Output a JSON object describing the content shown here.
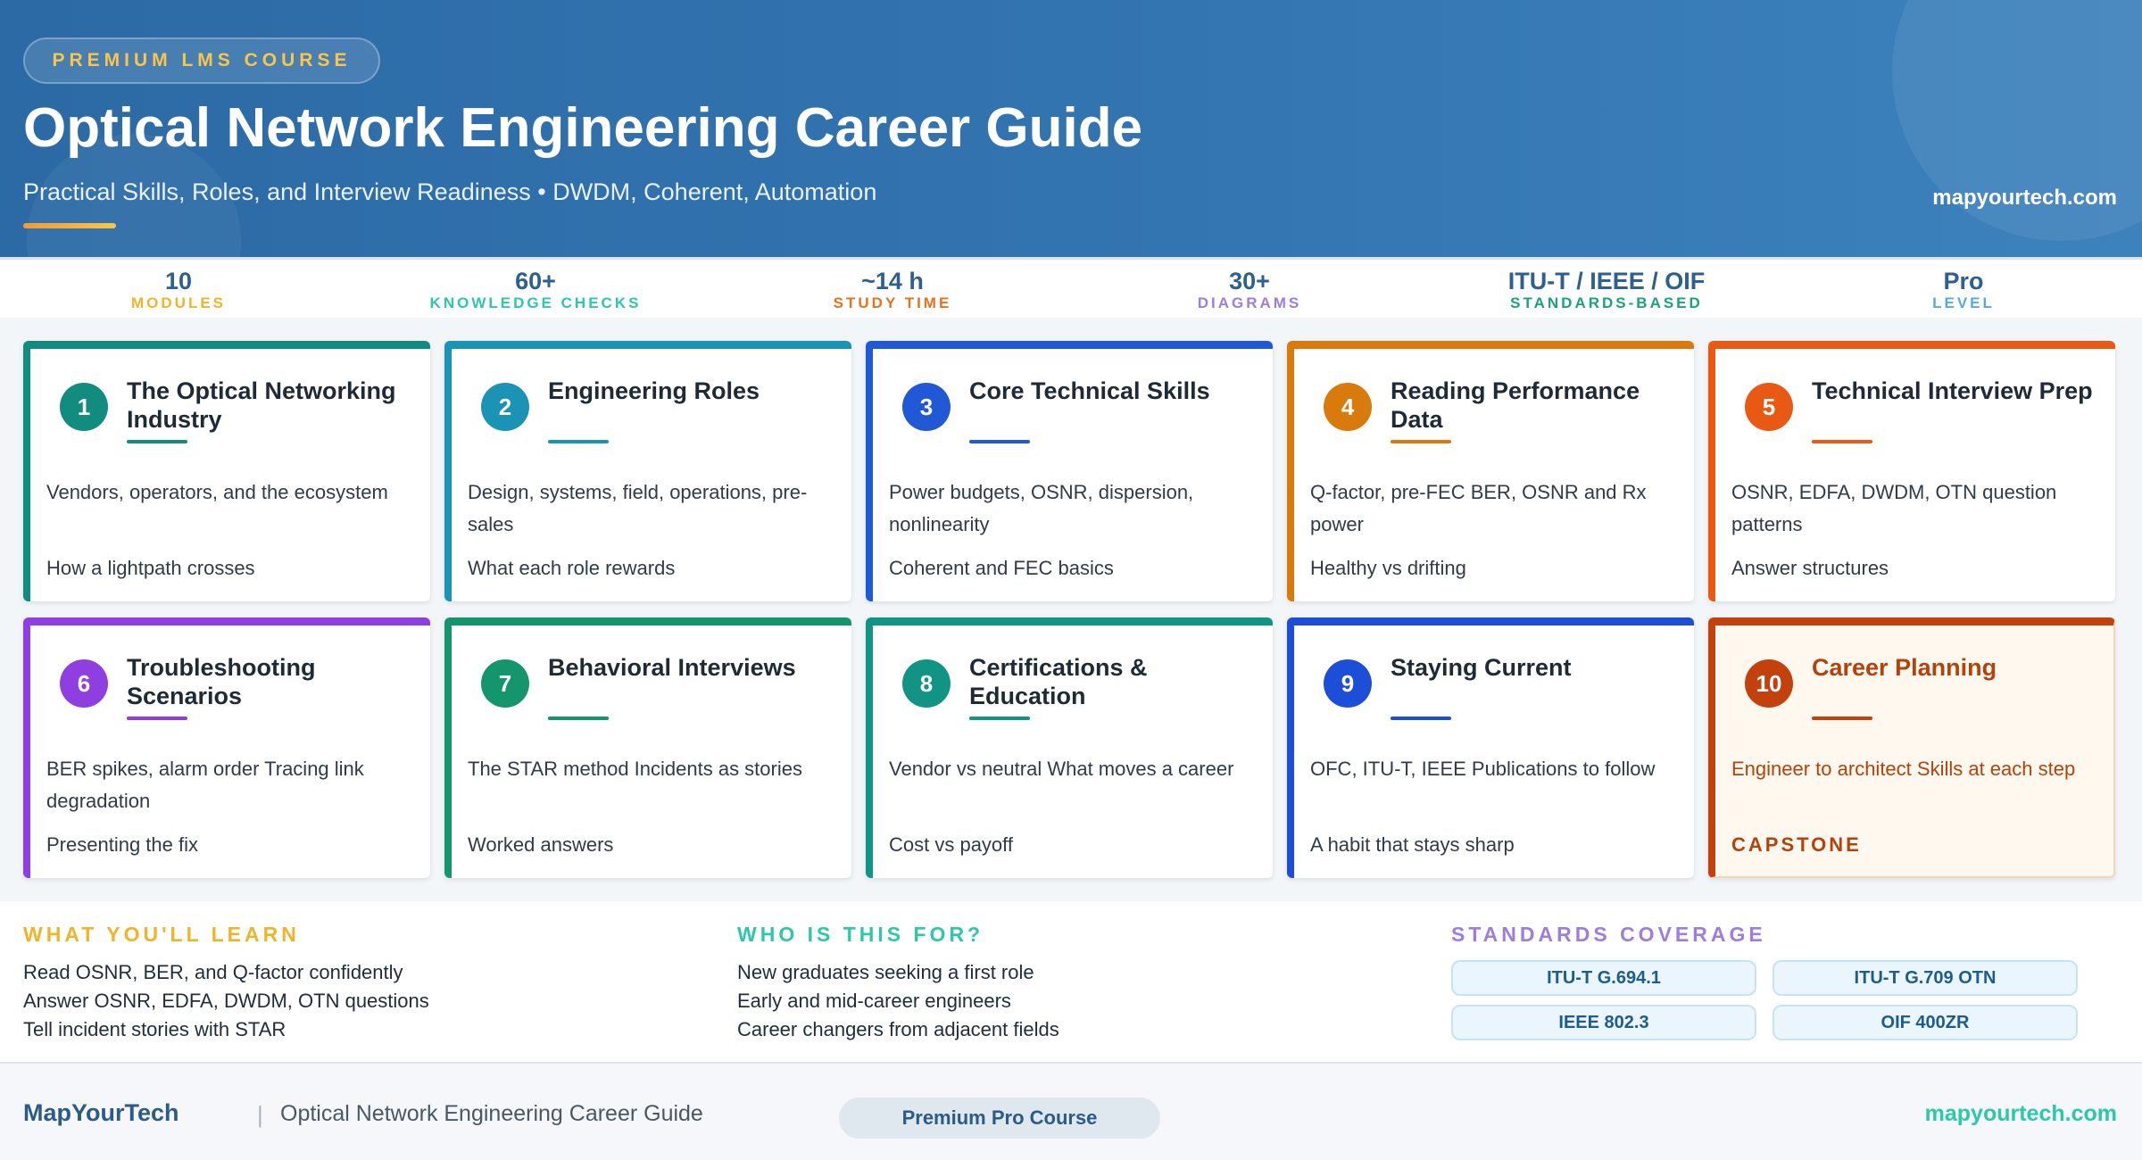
{
  "header": {
    "badge": "PREMIUM LMS COURSE",
    "title": "Optical Network Engineering Career Guide",
    "subtitle": "Practical Skills, Roles, and Interview Readiness • DWDM, Coherent, Automation",
    "site": "mapyourtech.com"
  },
  "stats": [
    {
      "value": "10",
      "label": "MODULES",
      "color": "#f0b429"
    },
    {
      "value": "60+",
      "label": "KNOWLEDGE CHECKS",
      "color": "#2cc8a8"
    },
    {
      "value": "~14 h",
      "label": "STUDY TIME",
      "color": "#e8711f"
    },
    {
      "value": "30+",
      "label": "DIAGRAMS",
      "color": "#9d7de0"
    },
    {
      "value": "ITU-T / IEEE / OIF",
      "label": "STANDARDS-BASED",
      "color": "#1aa37a"
    },
    {
      "value": "Pro",
      "label": "LEVEL",
      "color": "#5aa9dc"
    }
  ],
  "modules": [
    {
      "num": "1",
      "title": "The Optical Networking Industry",
      "desc": "Vendors, operators, and the ecosystem",
      "extra": "How a lightpath crosses",
      "color": "#128c7e"
    },
    {
      "num": "2",
      "title": "Engineering Roles",
      "desc": "Design, systems, field, operations, pre-sales",
      "extra": "What each role rewards",
      "color": "#1a93b5"
    },
    {
      "num": "3",
      "title": "Core Technical Skills",
      "desc": "Power budgets, OSNR, dispersion, nonlinearity",
      "extra": "Coherent and FEC basics",
      "color": "#2158d6"
    },
    {
      "num": "4",
      "title": "Reading Performance Data",
      "desc": "Q-factor, pre-FEC BER, OSNR and Rx power",
      "extra": "Healthy vs drifting",
      "color": "#d97a0c"
    },
    {
      "num": "5",
      "title": "Technical Interview Prep",
      "desc": "OSNR, EDFA, DWDM, OTN question patterns",
      "extra": "Answer structures",
      "color": "#e85a14"
    },
    {
      "num": "6",
      "title": "Troubleshooting Scenarios",
      "desc": "BER spikes, alarm order Tracing link degradation",
      "extra": "Presenting the fix",
      "color": "#8f3fe0"
    },
    {
      "num": "7",
      "title": "Behavioral Interviews",
      "desc": "The STAR method Incidents as stories",
      "extra": "Worked answers",
      "color": "#15956b"
    },
    {
      "num": "8",
      "title": "Certifications & Education",
      "desc": "Vendor vs neutral What moves a career",
      "extra": "Cost vs payoff",
      "color": "#129485"
    },
    {
      "num": "9",
      "title": "Staying Current",
      "desc": "OFC, ITU-T, IEEE Publications to follow",
      "extra": "A habit that stays sharp",
      "color": "#1d4ed8"
    },
    {
      "num": "10",
      "title": "Career Planning",
      "desc": "Engineer to architect Skills at each step",
      "extra": "CAPSTONE",
      "color": "#c2410c"
    }
  ],
  "learn": {
    "heading": "WHAT YOU'LL LEARN",
    "items": [
      "Read OSNR, BER, and Q-factor confidently",
      "Answer OSNR, EDFA, DWDM, OTN questions",
      "Tell incident stories with STAR"
    ],
    "color": "#f0b429"
  },
  "audience": {
    "heading": "WHO IS THIS FOR?",
    "items": [
      "New graduates seeking a first role",
      "Early and mid-career engineers",
      "Career changers from adjacent fields"
    ],
    "color": "#2cc8a8"
  },
  "standards": {
    "heading": "STANDARDS COVERAGE",
    "items": [
      "ITU-T G.694.1",
      "ITU-T G.709 OTN",
      "IEEE 802.3",
      "OIF 400ZR"
    ],
    "color": "#9d7de0"
  },
  "footer": {
    "brand": "MapYourTech",
    "separator": "|",
    "title": "Optical Network Engineering Career Guide",
    "pill": "Premium Pro Course",
    "site": "mapyourtech.com"
  }
}
